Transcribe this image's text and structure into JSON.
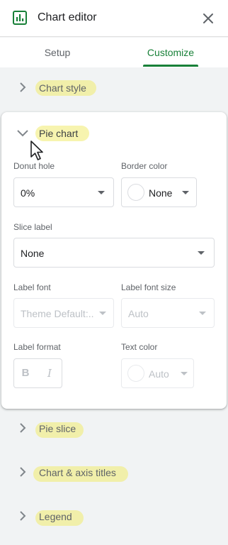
{
  "header": {
    "title": "Chart editor",
    "chart_icon": "chart-icon",
    "close_icon": "close-icon"
  },
  "tabs": [
    {
      "label": "Setup",
      "active": false
    },
    {
      "label": "Customize",
      "active": true
    }
  ],
  "sections": {
    "chart_style": "Chart style",
    "pie_chart": "Pie chart",
    "pie_slice": "Pie slice",
    "chart_axis_titles": "Chart & axis titles",
    "legend": "Legend"
  },
  "pie_chart": {
    "donut_hole": {
      "label": "Donut hole",
      "value": "0%"
    },
    "border_color": {
      "label": "Border color",
      "value": "None"
    },
    "slice_label": {
      "label": "Slice label",
      "value": "None"
    },
    "label_font": {
      "label": "Label font",
      "value": "Theme Default:..."
    },
    "label_font_size": {
      "label": "Label font size",
      "value": "Auto"
    },
    "label_format": {
      "label": "Label format",
      "bold": "B",
      "italic": "I"
    },
    "text_color": {
      "label": "Text color",
      "value": "Auto"
    }
  },
  "colors": {
    "accent": "#188038",
    "highlight": "#f0eb6e"
  }
}
